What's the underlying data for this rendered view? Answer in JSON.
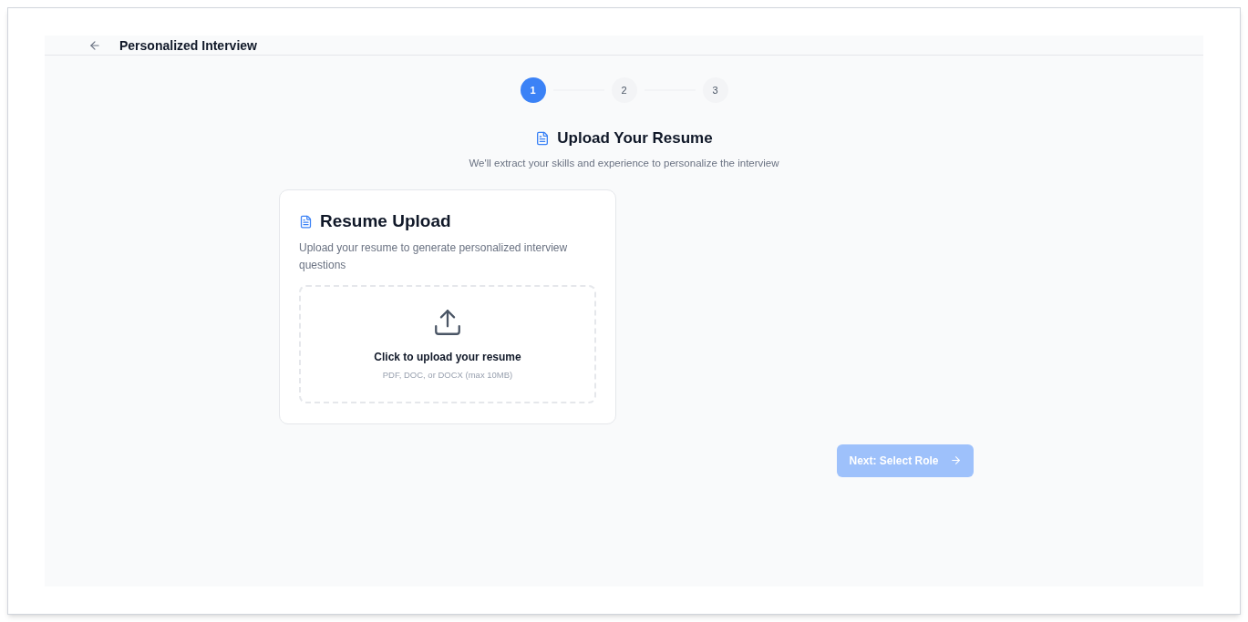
{
  "header": {
    "title": "Personalized Interview"
  },
  "steps": [
    {
      "label": "1",
      "selected": true
    },
    {
      "label": "2",
      "selected": false
    },
    {
      "label": "3",
      "selected": false
    }
  ],
  "section": {
    "title": "Upload Your Resume",
    "subtitle": "We'll extract your skills and experience to personalize the interview"
  },
  "card": {
    "title": "Resume Upload",
    "description": "Upload your resume to generate personalized interview questions",
    "dropzone": {
      "title": "Click to upload your resume",
      "hint": "PDF, DOC, or DOCX (max 10MB)"
    }
  },
  "next_button": {
    "label": "Next: Select Role",
    "disabled": true
  }
}
